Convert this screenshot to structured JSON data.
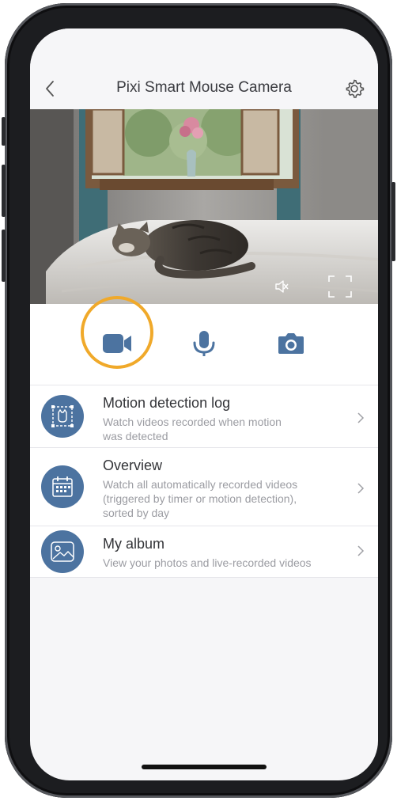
{
  "header": {
    "title": "Pixi Smart Mouse Camera"
  },
  "icons": {
    "back": "chevron-left-icon",
    "settings": "gear-icon",
    "mute": "speaker-muted-icon",
    "fullscreen": "fullscreen-icon",
    "record": "video-camera-icon",
    "microphone": "microphone-icon",
    "snapshot": "camera-icon"
  },
  "colors": {
    "accent": "#4c73a0",
    "highlight": "#f0a92a",
    "background": "#f6f6f8"
  },
  "menu": [
    {
      "title": "Motion detection log",
      "desc_line1": "Watch videos recorded when motion",
      "desc_line2": "was detected",
      "desc_line3": "",
      "icon": "motion-detection-icon"
    },
    {
      "title": "Overview",
      "desc_line1": "Watch all automatically recorded videos",
      "desc_line2": "(triggered by timer or motion detection),",
      "desc_line3": "sorted by day",
      "icon": "calendar-icon"
    },
    {
      "title": "My album",
      "desc_line1": "View your photos and live-recorded videos",
      "desc_line2": "",
      "desc_line3": "",
      "icon": "photo-album-icon"
    }
  ]
}
